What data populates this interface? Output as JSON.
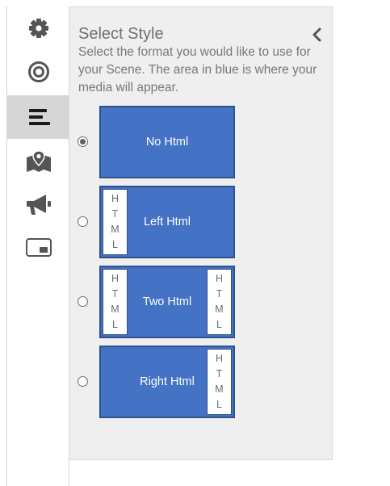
{
  "sidebar": {
    "items": [
      {
        "icon": "gear-icon",
        "active": false
      },
      {
        "icon": "target-icon",
        "active": false
      },
      {
        "icon": "hamburger-menu-icon",
        "active": true
      },
      {
        "icon": "map-pin-icon",
        "active": false
      },
      {
        "icon": "megaphone-icon",
        "active": false
      },
      {
        "icon": "picture-in-picture-icon",
        "active": false
      }
    ]
  },
  "panel": {
    "title": "Select Style",
    "description": "Select the format you would like to use for your Scene. The area in blue is where your media will appear.",
    "collapse_icon": "chevron-left-icon",
    "options": [
      {
        "label": "No Html",
        "selected": true
      },
      {
        "label": "Left Html",
        "selected": false
      },
      {
        "label": "Two Html",
        "selected": false
      },
      {
        "label": "Right Html",
        "selected": false
      }
    ],
    "html_letters": [
      "H",
      "T",
      "M",
      "L"
    ]
  },
  "colors": {
    "preview_blue": "#4472c4",
    "preview_border": "#2f528f",
    "panel_bg": "#efefef",
    "active_nav_bg": "#d6d6d6"
  }
}
